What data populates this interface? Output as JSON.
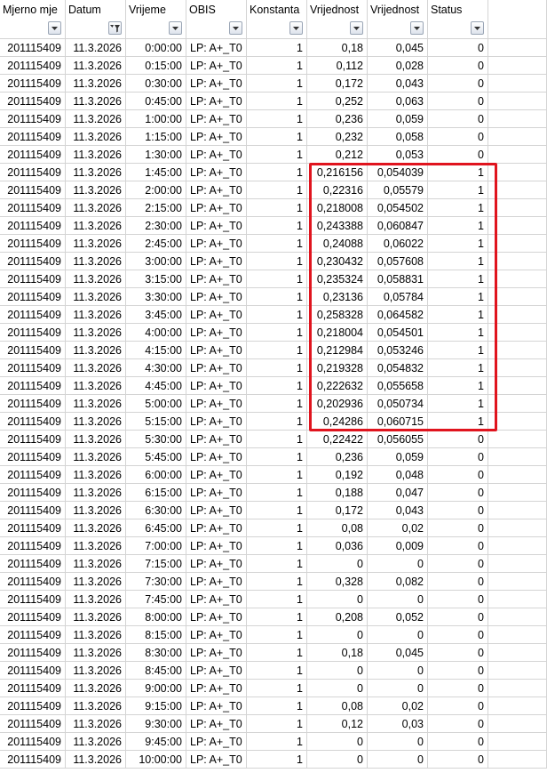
{
  "columns": [
    {
      "label": "Mjerno mje",
      "filter": "dropdown"
    },
    {
      "label": "Datum",
      "filter": "filtered"
    },
    {
      "label": "Vrijeme",
      "filter": "dropdown"
    },
    {
      "label": "OBIS",
      "filter": "dropdown"
    },
    {
      "label": "Konstanta",
      "filter": "dropdown"
    },
    {
      "label": "Vrijednost",
      "filter": "dropdown"
    },
    {
      "label": "Vrijednost",
      "filter": "dropdown"
    },
    {
      "label": "Status",
      "filter": "dropdown"
    }
  ],
  "highlight": {
    "color": "#e0141e",
    "rows": "1:45:00–5:15:00",
    "columns": "Vrijednost, Vrijednost, Status"
  },
  "rows": [
    [
      "201115409",
      "11.3.2026",
      "0:00:00",
      "LP: A+_T0",
      "1",
      "0,18",
      "0,045",
      "0"
    ],
    [
      "201115409",
      "11.3.2026",
      "0:15:00",
      "LP: A+_T0",
      "1",
      "0,112",
      "0,028",
      "0"
    ],
    [
      "201115409",
      "11.3.2026",
      "0:30:00",
      "LP: A+_T0",
      "1",
      "0,172",
      "0,043",
      "0"
    ],
    [
      "201115409",
      "11.3.2026",
      "0:45:00",
      "LP: A+_T0",
      "1",
      "0,252",
      "0,063",
      "0"
    ],
    [
      "201115409",
      "11.3.2026",
      "1:00:00",
      "LP: A+_T0",
      "1",
      "0,236",
      "0,059",
      "0"
    ],
    [
      "201115409",
      "11.3.2026",
      "1:15:00",
      "LP: A+_T0",
      "1",
      "0,232",
      "0,058",
      "0"
    ],
    [
      "201115409",
      "11.3.2026",
      "1:30:00",
      "LP: A+_T0",
      "1",
      "0,212",
      "0,053",
      "0"
    ],
    [
      "201115409",
      "11.3.2026",
      "1:45:00",
      "LP: A+_T0",
      "1",
      "0,216156",
      "0,054039",
      "1"
    ],
    [
      "201115409",
      "11.3.2026",
      "2:00:00",
      "LP: A+_T0",
      "1",
      "0,22316",
      "0,05579",
      "1"
    ],
    [
      "201115409",
      "11.3.2026",
      "2:15:00",
      "LP: A+_T0",
      "1",
      "0,218008",
      "0,054502",
      "1"
    ],
    [
      "201115409",
      "11.3.2026",
      "2:30:00",
      "LP: A+_T0",
      "1",
      "0,243388",
      "0,060847",
      "1"
    ],
    [
      "201115409",
      "11.3.2026",
      "2:45:00",
      "LP: A+_T0",
      "1",
      "0,24088",
      "0,06022",
      "1"
    ],
    [
      "201115409",
      "11.3.2026",
      "3:00:00",
      "LP: A+_T0",
      "1",
      "0,230432",
      "0,057608",
      "1"
    ],
    [
      "201115409",
      "11.3.2026",
      "3:15:00",
      "LP: A+_T0",
      "1",
      "0,235324",
      "0,058831",
      "1"
    ],
    [
      "201115409",
      "11.3.2026",
      "3:30:00",
      "LP: A+_T0",
      "1",
      "0,23136",
      "0,05784",
      "1"
    ],
    [
      "201115409",
      "11.3.2026",
      "3:45:00",
      "LP: A+_T0",
      "1",
      "0,258328",
      "0,064582",
      "1"
    ],
    [
      "201115409",
      "11.3.2026",
      "4:00:00",
      "LP: A+_T0",
      "1",
      "0,218004",
      "0,054501",
      "1"
    ],
    [
      "201115409",
      "11.3.2026",
      "4:15:00",
      "LP: A+_T0",
      "1",
      "0,212984",
      "0,053246",
      "1"
    ],
    [
      "201115409",
      "11.3.2026",
      "4:30:00",
      "LP: A+_T0",
      "1",
      "0,219328",
      "0,054832",
      "1"
    ],
    [
      "201115409",
      "11.3.2026",
      "4:45:00",
      "LP: A+_T0",
      "1",
      "0,222632",
      "0,055658",
      "1"
    ],
    [
      "201115409",
      "11.3.2026",
      "5:00:00",
      "LP: A+_T0",
      "1",
      "0,202936",
      "0,050734",
      "1"
    ],
    [
      "201115409",
      "11.3.2026",
      "5:15:00",
      "LP: A+_T0",
      "1",
      "0,24286",
      "0,060715",
      "1"
    ],
    [
      "201115409",
      "11.3.2026",
      "5:30:00",
      "LP: A+_T0",
      "1",
      "0,22422",
      "0,056055",
      "0"
    ],
    [
      "201115409",
      "11.3.2026",
      "5:45:00",
      "LP: A+_T0",
      "1",
      "0,236",
      "0,059",
      "0"
    ],
    [
      "201115409",
      "11.3.2026",
      "6:00:00",
      "LP: A+_T0",
      "1",
      "0,192",
      "0,048",
      "0"
    ],
    [
      "201115409",
      "11.3.2026",
      "6:15:00",
      "LP: A+_T0",
      "1",
      "0,188",
      "0,047",
      "0"
    ],
    [
      "201115409",
      "11.3.2026",
      "6:30:00",
      "LP: A+_T0",
      "1",
      "0,172",
      "0,043",
      "0"
    ],
    [
      "201115409",
      "11.3.2026",
      "6:45:00",
      "LP: A+_T0",
      "1",
      "0,08",
      "0,02",
      "0"
    ],
    [
      "201115409",
      "11.3.2026",
      "7:00:00",
      "LP: A+_T0",
      "1",
      "0,036",
      "0,009",
      "0"
    ],
    [
      "201115409",
      "11.3.2026",
      "7:15:00",
      "LP: A+_T0",
      "1",
      "0",
      "0",
      "0"
    ],
    [
      "201115409",
      "11.3.2026",
      "7:30:00",
      "LP: A+_T0",
      "1",
      "0,328",
      "0,082",
      "0"
    ],
    [
      "201115409",
      "11.3.2026",
      "7:45:00",
      "LP: A+_T0",
      "1",
      "0",
      "0",
      "0"
    ],
    [
      "201115409",
      "11.3.2026",
      "8:00:00",
      "LP: A+_T0",
      "1",
      "0,208",
      "0,052",
      "0"
    ],
    [
      "201115409",
      "11.3.2026",
      "8:15:00",
      "LP: A+_T0",
      "1",
      "0",
      "0",
      "0"
    ],
    [
      "201115409",
      "11.3.2026",
      "8:30:00",
      "LP: A+_T0",
      "1",
      "0,18",
      "0,045",
      "0"
    ],
    [
      "201115409",
      "11.3.2026",
      "8:45:00",
      "LP: A+_T0",
      "1",
      "0",
      "0",
      "0"
    ],
    [
      "201115409",
      "11.3.2026",
      "9:00:00",
      "LP: A+_T0",
      "1",
      "0",
      "0",
      "0"
    ],
    [
      "201115409",
      "11.3.2026",
      "9:15:00",
      "LP: A+_T0",
      "1",
      "0,08",
      "0,02",
      "0"
    ],
    [
      "201115409",
      "11.3.2026",
      "9:30:00",
      "LP: A+_T0",
      "1",
      "0,12",
      "0,03",
      "0"
    ],
    [
      "201115409",
      "11.3.2026",
      "9:45:00",
      "LP: A+_T0",
      "1",
      "0",
      "0",
      "0"
    ],
    [
      "201115409",
      "11.3.2026",
      "10:00:00",
      "LP: A+_T0",
      "1",
      "0",
      "0",
      "0"
    ]
  ]
}
